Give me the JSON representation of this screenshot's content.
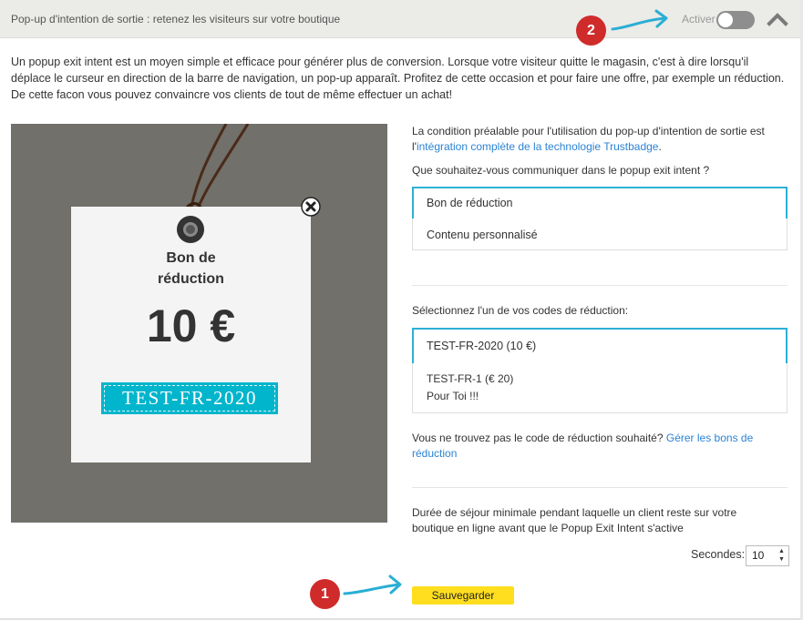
{
  "header": {
    "title": "Pop-up d'intention de sortie : retenez les visiteurs sur votre boutique",
    "toggle_label": "Activer",
    "toggle_state": "off",
    "collapse_icon": "chevron-up-icon"
  },
  "annotations": {
    "badge1": "1",
    "badge2": "2",
    "color": "#cf2b2b",
    "arrow_color": "#2aaed4"
  },
  "intro": "Un popup exit intent est un moyen simple et efficace pour générer plus de conversion. Lorsque votre visiteur quitte le magasin, c'est à dire lorsqu'il déplace le curseur en direction de la barre de navigation, un pop-up apparaît. Profitez de cette occasion et pour faire une offre, par exemple un réduction. De cette facon vous pouvez convaincre vos clients de tout de même effectuer un achat!",
  "preview": {
    "title_line1": "Bon de",
    "title_line2": "réduction",
    "amount": "10 €",
    "code": "TEST-FR-2020",
    "close_icon": "close-icon",
    "background": "#71706a",
    "code_color": "#00b5cc"
  },
  "settings": {
    "prereq_text": "La condition préalable pour l'utilisation du pop-up d'intention de sortie est l'",
    "prereq_link": "intégration complète de la technologie Trustbadge",
    "prereq_end": ".",
    "question": "Que souhaitez-vous communiquer dans le popup exit intent ?",
    "content_options": [
      "Bon de réduction",
      "Contenu personnalisé"
    ],
    "select_code_label": "Sélectionnez l'un de vos codes de réduction:",
    "codes": [
      {
        "line1": "TEST-FR-2020 (10 €)",
        "line2": ""
      },
      {
        "line1": "TEST-FR-1 (€ 20)",
        "line2": "Pour Toi !!!"
      }
    ],
    "not_found_text": "Vous ne trouvez pas le code de réduction souhaité? ",
    "manage_link": "Gérer les bons de réduction",
    "duration_text": "Durée de séjour minimale pendant laquelle un client reste sur votre boutique en ligne avant que le Popup Exit Intent s'active",
    "seconds_label": "Secondes:",
    "seconds_value": "10"
  },
  "save_label": "Sauvegarder",
  "accent": "#2cb1d6",
  "save_color": "#ffde1f"
}
